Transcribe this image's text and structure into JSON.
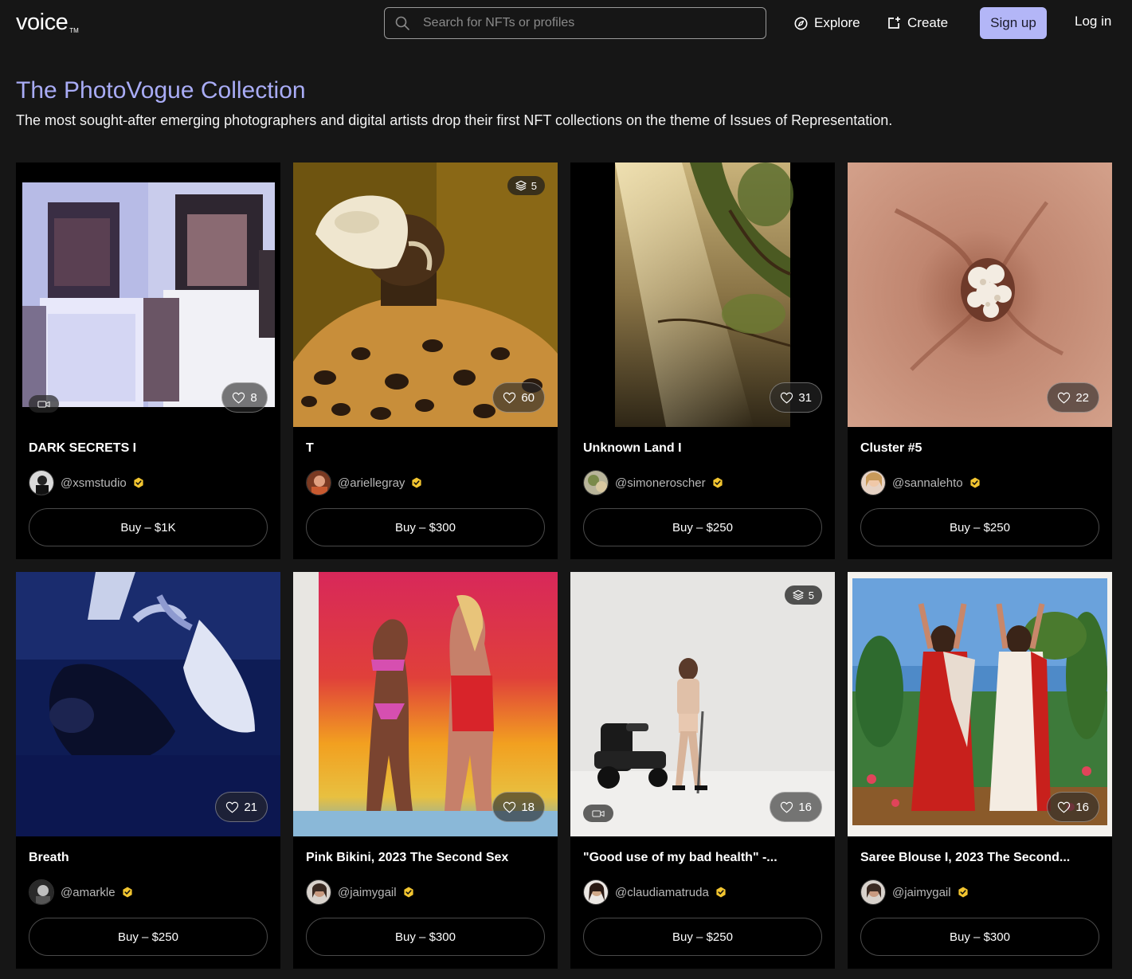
{
  "nav": {
    "logo": "voice",
    "logo_mark": "TM",
    "search_placeholder": "Search for NFTs or profiles",
    "explore_label": "Explore",
    "create_label": "Create",
    "signup_label": "Sign up",
    "login_label": "Log in"
  },
  "header": {
    "title": "The PhotoVogue Collection",
    "subtitle": "The most sought-after emerging photographers and digital artists drop their first NFT collections on the theme of Issues of Representation."
  },
  "colors": {
    "accent": "#a9acf6",
    "signup_bg": "#b3b6f7",
    "verified": "#f2c530",
    "page_bg": "#161616",
    "card_bg": "#000000"
  },
  "cards": [
    {
      "title": "DARK SECRETS I",
      "handle": "@xsmstudio",
      "likes": "8",
      "buy": "Buy – $1K",
      "video": true,
      "edition": ""
    },
    {
      "title": "T",
      "handle": "@ariellegray",
      "likes": "60",
      "buy": "Buy – $300",
      "video": false,
      "edition": "5"
    },
    {
      "title": "Unknown Land I",
      "handle": "@simoneroscher",
      "likes": "31",
      "buy": "Buy – $250",
      "video": false,
      "edition": ""
    },
    {
      "title": "Cluster #5",
      "handle": "@sannalehto",
      "likes": "22",
      "buy": "Buy – $250",
      "video": false,
      "edition": ""
    },
    {
      "title": "Breath",
      "handle": "@amarkle",
      "likes": "21",
      "buy": "Buy – $250",
      "video": false,
      "edition": ""
    },
    {
      "title": "Pink Bikini, 2023 The Second Sex",
      "handle": "@jaimygail",
      "likes": "18",
      "buy": "Buy – $300",
      "video": false,
      "edition": ""
    },
    {
      "title": "\"Good use of my bad health\" -...",
      "handle": "@claudiamatruda",
      "likes": "16",
      "buy": "Buy – $250",
      "video": true,
      "edition": "5"
    },
    {
      "title": "Saree Blouse I, 2023 The Second...",
      "handle": "@jaimygail",
      "likes": "16",
      "buy": "Buy – $300",
      "video": false,
      "edition": ""
    }
  ]
}
